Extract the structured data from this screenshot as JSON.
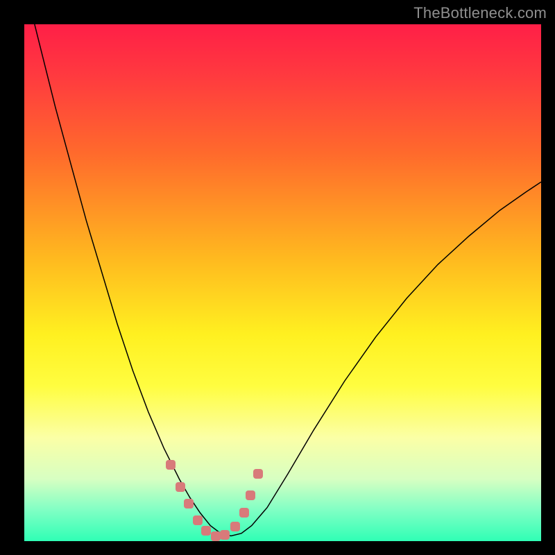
{
  "watermark": "TheBottleneck.com",
  "chart_data": {
    "type": "line",
    "title": "",
    "xlabel": "",
    "ylabel": "",
    "xlim": [
      0,
      1
    ],
    "ylim": [
      0,
      1
    ],
    "grid": false,
    "note": "No numeric axis ticks are visible; x and y are normalized 0–1 fractions of the plot area (x left→right, y bottom→top). Curve is a V-shaped bottleneck profile dipping near zero around x≈0.37.",
    "series": [
      {
        "name": "bottleneck-curve",
        "x": [
          0.0,
          0.03,
          0.06,
          0.09,
          0.12,
          0.15,
          0.18,
          0.21,
          0.24,
          0.27,
          0.3,
          0.32,
          0.34,
          0.36,
          0.38,
          0.4,
          0.42,
          0.44,
          0.47,
          0.51,
          0.56,
          0.62,
          0.68,
          0.74,
          0.8,
          0.86,
          0.92,
          0.97,
          1.0
        ],
        "y": [
          1.08,
          0.96,
          0.84,
          0.73,
          0.62,
          0.52,
          0.42,
          0.33,
          0.25,
          0.18,
          0.12,
          0.085,
          0.055,
          0.03,
          0.015,
          0.01,
          0.015,
          0.03,
          0.065,
          0.13,
          0.215,
          0.31,
          0.395,
          0.47,
          0.535,
          0.59,
          0.64,
          0.675,
          0.695
        ]
      }
    ],
    "highlight_markers": {
      "name": "curve-near-minimum-markers",
      "x": [
        0.283,
        0.302,
        0.318,
        0.335,
        0.352,
        0.37,
        0.388,
        0.408,
        0.425,
        0.438,
        0.452
      ],
      "y": [
        0.148,
        0.105,
        0.072,
        0.04,
        0.02,
        0.01,
        0.012,
        0.028,
        0.055,
        0.088,
        0.13
      ]
    },
    "background_gradient": {
      "top_color": "#ff1f47",
      "bottom_color": "#2fffb5",
      "stops": [
        "#ff1f47",
        "#ff3a3f",
        "#ff6a2c",
        "#ffb81f",
        "#fff020",
        "#fffd40",
        "#fbffa6",
        "#d7ffc2",
        "#80ffc4",
        "#2fffb5"
      ]
    }
  }
}
